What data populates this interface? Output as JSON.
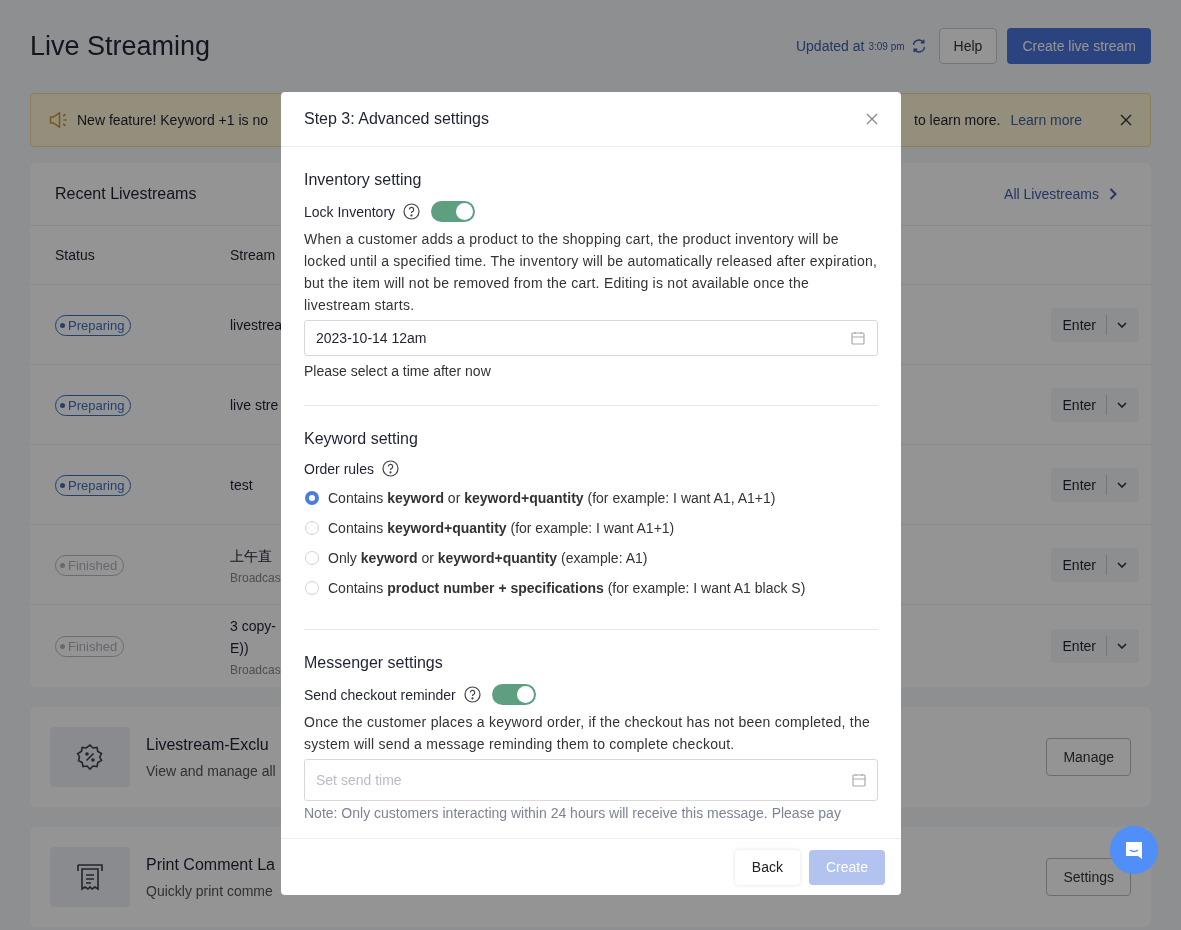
{
  "page": {
    "title": "Live Streaming",
    "updated_label": "Updated at",
    "updated_time": "3:09 pm",
    "help_button": "Help",
    "create_button": "Create live stream"
  },
  "banner": {
    "text_start": "New feature! Keyword +1 is no",
    "text_end": "to learn more.",
    "link": "Learn more"
  },
  "recent": {
    "title": "Recent Livestreams",
    "all_link": "All Livestreams",
    "columns": [
      "Status",
      "Stream"
    ],
    "rows": [
      {
        "kind": "active",
        "status": "Preparing",
        "name": "livestrea",
        "enter": "Enter"
      },
      {
        "kind": "active",
        "status": "Preparing",
        "name": "live stre",
        "enter": "Enter"
      },
      {
        "kind": "active",
        "status": "Preparing",
        "name": "test",
        "enter": "Enter"
      },
      {
        "kind": "ended",
        "status": "Finished",
        "name": "上午直",
        "subtitle": "Broadcas",
        "enter": "Enter"
      },
      {
        "kind": "ended",
        "status": "Finished",
        "name": "3 copy-\nE))",
        "subtitle": "Broadcas",
        "enter": "Enter"
      }
    ]
  },
  "features": [
    {
      "kind": "coupon",
      "title": "Livestream-Exclu",
      "desc": "View and manage all",
      "button": "Manage"
    },
    {
      "kind": "printer",
      "title": "Print Comment La",
      "desc": "Quickly print comme",
      "button": "Settings"
    }
  ],
  "modal": {
    "title": "Step 3: Advanced settings",
    "inventory": {
      "heading": "Inventory setting",
      "toggle_label": "Lock Inventory",
      "on": true,
      "description": "When a customer adds a product to the shopping cart, the product inventory will be locked until a specified time. The inventory will be automatically released after expiration, but the item will not be removed from the cart. Editing is not available once the livestream starts.",
      "date_value": "2023-10-14 12am",
      "hint": "Please select a time after now"
    },
    "keyword": {
      "heading": "Keyword setting",
      "label": "Order rules",
      "options": [
        {
          "text": "Contains **keyword** or **keyword+quantity** (for example: I want A1, A1+1)",
          "selected": true
        },
        {
          "text": "Contains **keyword+quantity** (for example: I want A1+1)",
          "selected": false
        },
        {
          "text": "Only **keyword** or **keyword+quantity** (example: A1)",
          "selected": false
        },
        {
          "text": "Contains **product number + specifications** (for example: I want A1 black S)",
          "selected": false
        }
      ]
    },
    "messenger": {
      "heading": "Messenger settings",
      "toggle_label": "Send checkout reminder",
      "on": true,
      "description": "Once the customer places a keyword order, if the checkout has not been completed, the system will send a message reminding them to complete checkout.",
      "placeholder": "Set send time",
      "note": "Note: Only customers interacting within 24 hours will receive this message. Please pay"
    },
    "back_button": "Back",
    "create_button": "Create",
    "create_disabled": true
  }
}
